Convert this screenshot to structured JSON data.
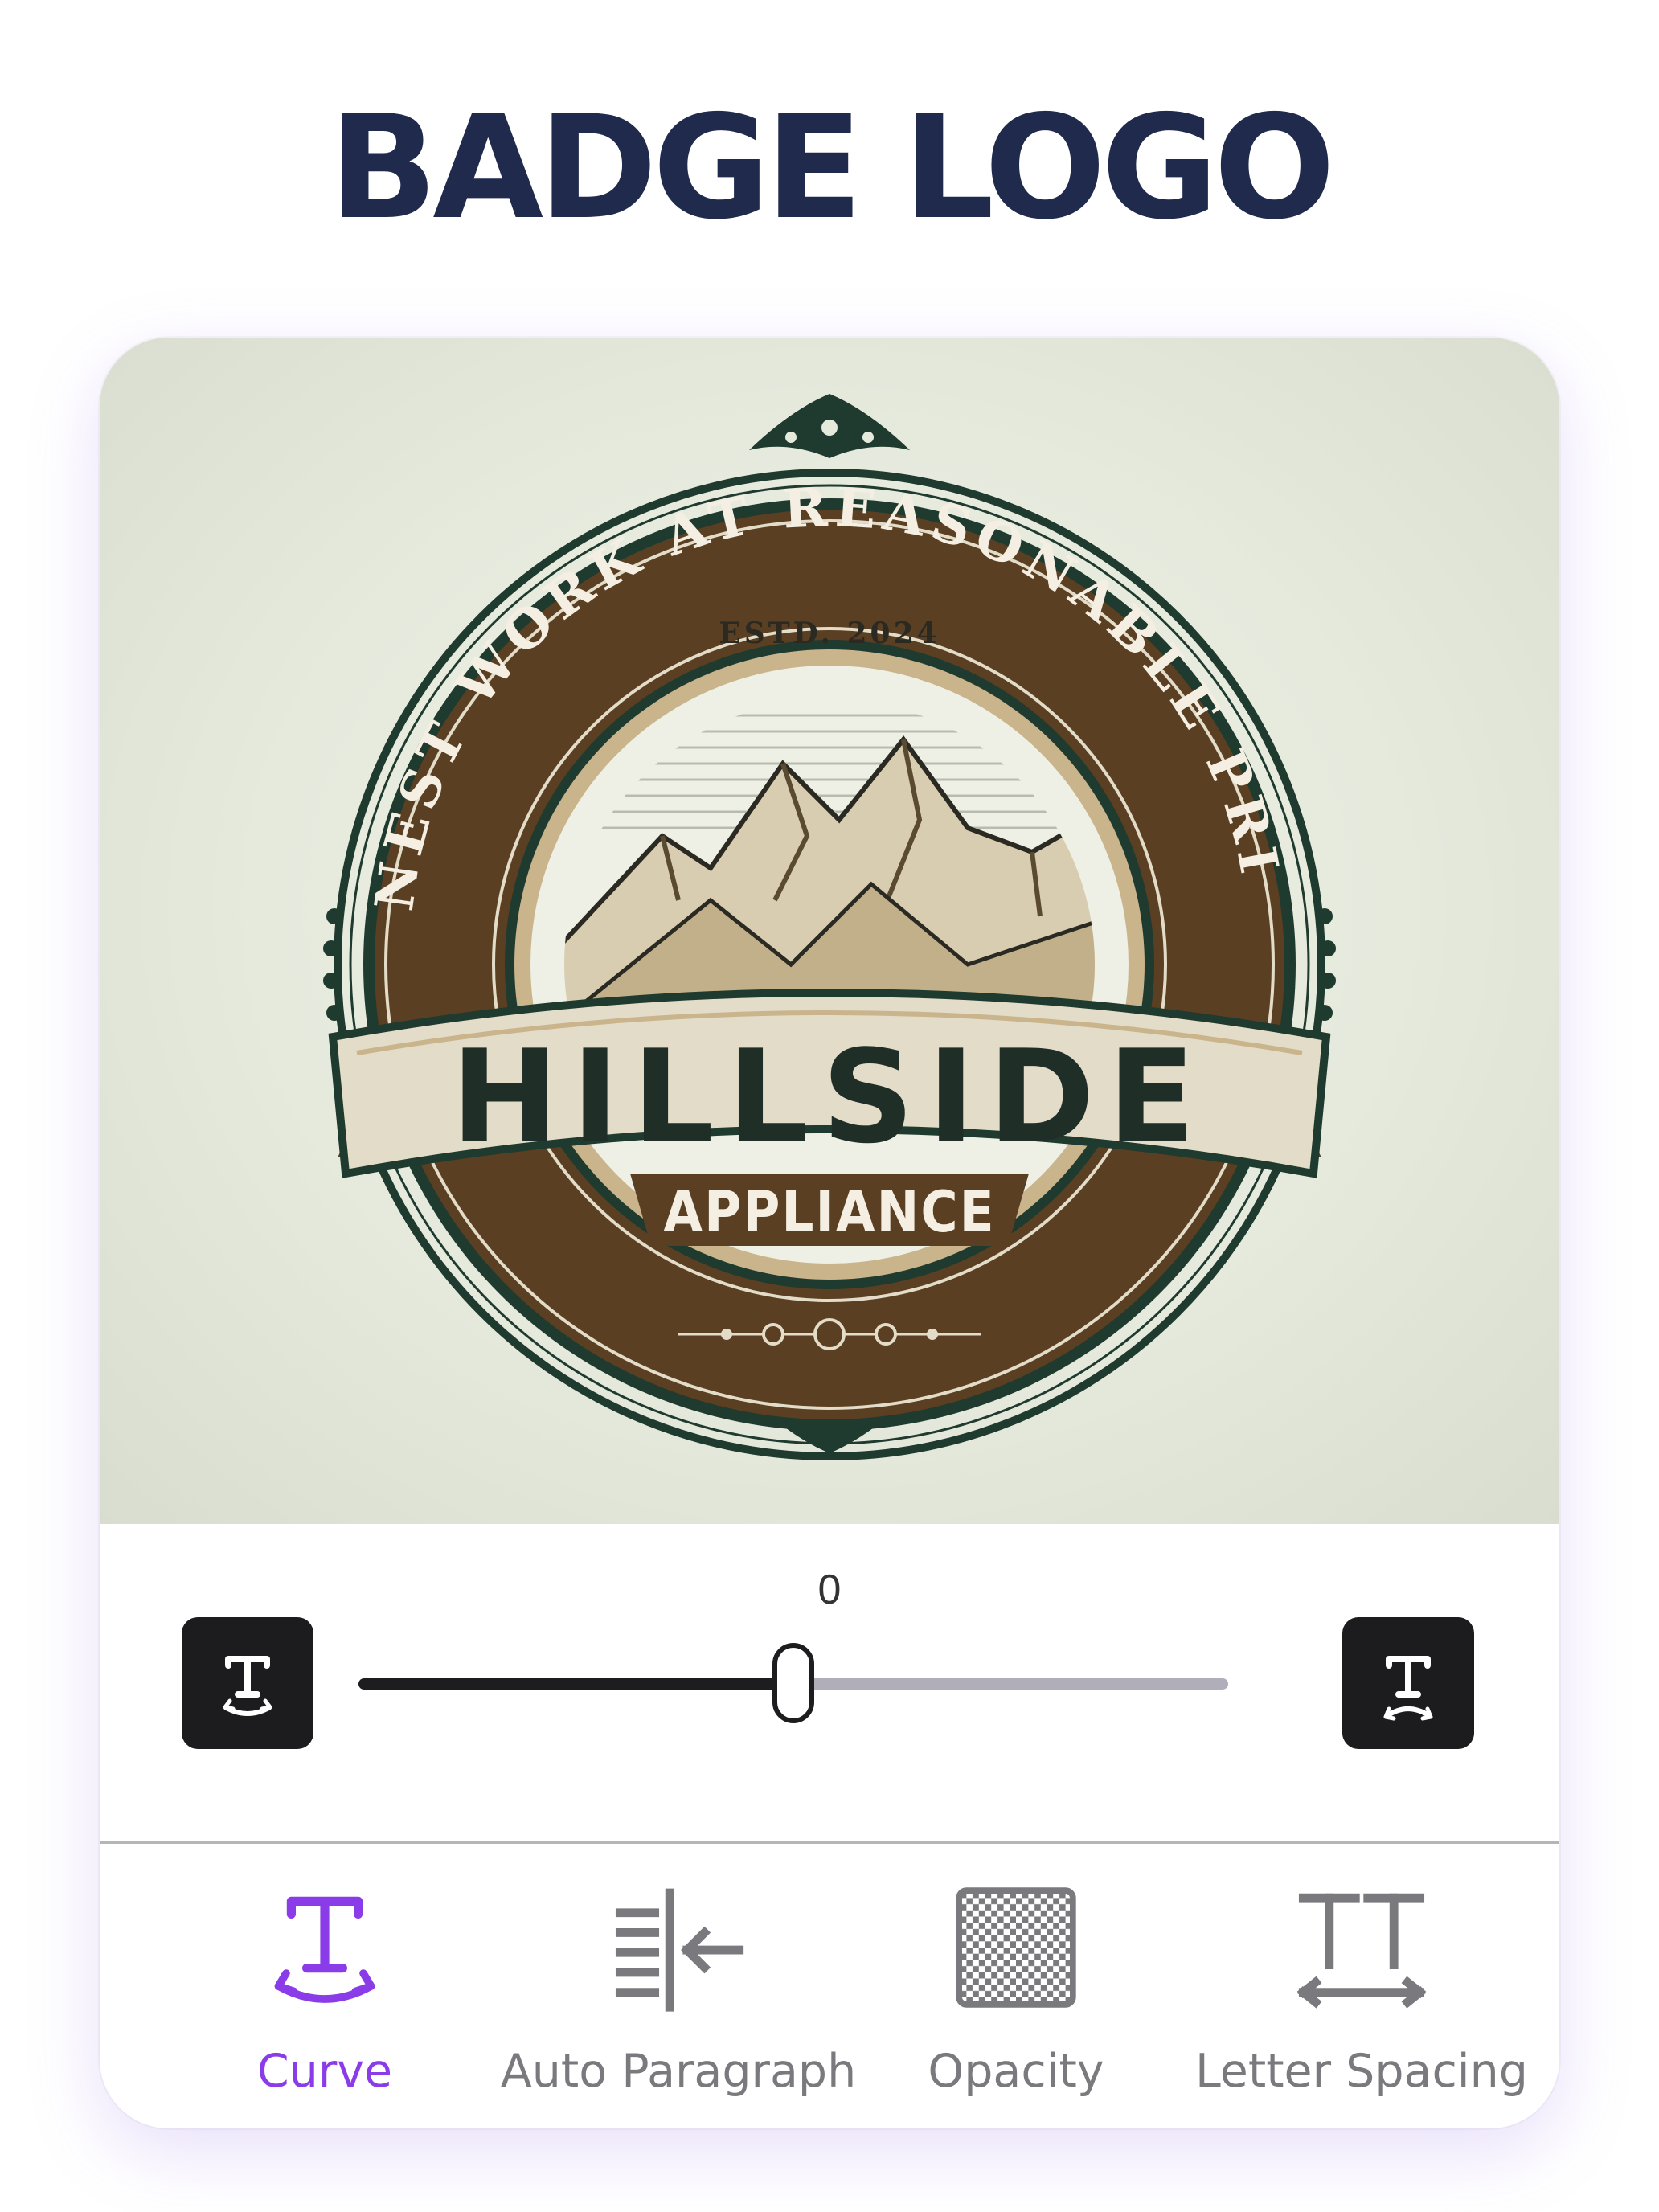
{
  "page": {
    "title": "BADGE LOGO"
  },
  "logo": {
    "arc_text": "HONEST WORK AT REASONABLE PRICES",
    "established": "ESTD. 2024",
    "brand": "HILLSIDE",
    "subbrand": "APPLIANCE"
  },
  "slider": {
    "value": "0",
    "fraction": 0.5
  },
  "toolbar": {
    "items": [
      {
        "label": "Curve",
        "icon": "curve-text-icon",
        "active": true
      },
      {
        "label": "Auto Paragraph",
        "icon": "auto-paragraph-icon",
        "active": false
      },
      {
        "label": "Opacity",
        "icon": "opacity-checker-icon",
        "active": false
      },
      {
        "label": "Letter Spacing",
        "icon": "letter-spacing-icon",
        "active": false
      }
    ]
  },
  "colors": {
    "title": "#1f2a4d",
    "accent": "#8a3ce8",
    "inactive": "#7a7a7e",
    "badge_brown": "#5a3f22",
    "badge_green": "#1f3a2e",
    "ribbon": "#e3dcc8"
  }
}
